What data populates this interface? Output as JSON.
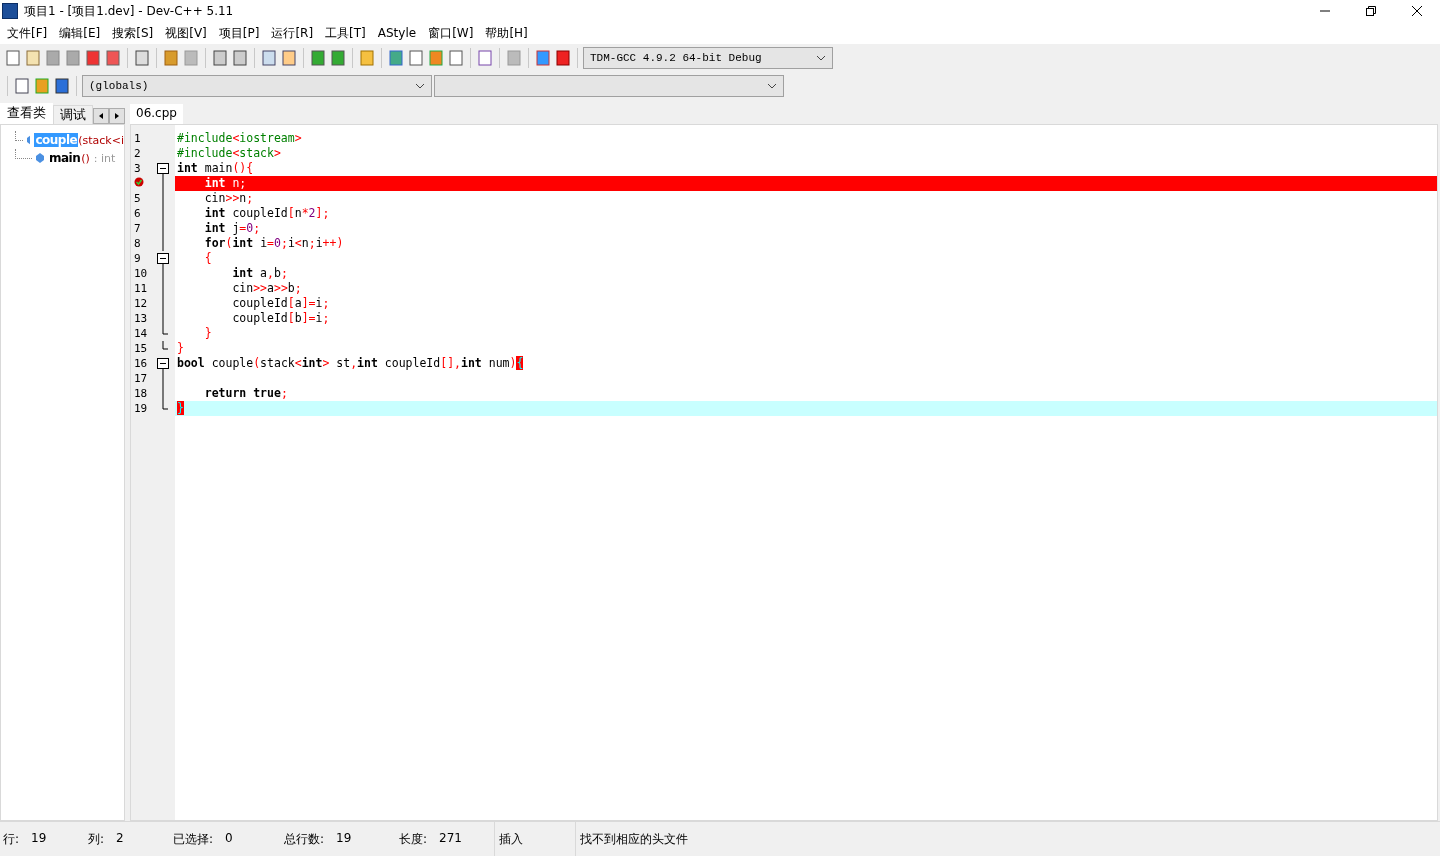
{
  "window": {
    "title": "项目1 - [项目1.dev] - Dev-C++ 5.11"
  },
  "menu": [
    "文件[F]",
    "编辑[E]",
    "搜索[S]",
    "视图[V]",
    "项目[P]",
    "运行[R]",
    "工具[T]",
    "AStyle",
    "窗口[W]",
    "帮助[H]"
  ],
  "compiler_select": {
    "value": "TDM-GCC 4.9.2 64-bit Debug"
  },
  "scope_select": {
    "value": "(globals)"
  },
  "left_tabs": [
    {
      "label": "查看类",
      "selected": true
    },
    {
      "label": "调试",
      "selected": false
    }
  ],
  "class_tree": [
    {
      "name": "couple",
      "signature": "(stack<i",
      "selected": true
    },
    {
      "name": "main",
      "signature": "()",
      "type": ": int",
      "selected": false
    }
  ],
  "editor_tabs": [
    {
      "label": "06.cpp",
      "selected": true
    }
  ],
  "code_lines": [
    {
      "number": "1",
      "text": "#include<iostream>",
      "kind": "preproc",
      "fold_start": false,
      "fold_end": false
    },
    {
      "number": "2",
      "text": "#include<stack>",
      "kind": "preproc",
      "fold_start": false,
      "fold_end": false
    },
    {
      "number": "3",
      "text": "**int** main(){",
      "kind": "code",
      "fold_start": true,
      "fold_end": false
    },
    {
      "text": "    **int** n;",
      "kind": "breakpoint",
      "fold_start": false,
      "fold_end": false
    },
    {
      "number": "5",
      "text": "    cin>>n;",
      "kind": "code",
      "fold_start": false,
      "fold_end": false
    },
    {
      "number": "6",
      "text": "    **int** coupleId[n*2];",
      "kind": "code",
      "fold_start": false,
      "fold_end": false
    },
    {
      "number": "7",
      "text": "    **int** j=0;",
      "kind": "code",
      "fold_start": false,
      "fold_end": false
    },
    {
      "number": "8",
      "text": "    **for**(**int** i=0;i<n;i++)",
      "kind": "code",
      "fold_start": false,
      "fold_end": false
    },
    {
      "number": "9",
      "text": "    {",
      "kind": "code",
      "fold_start": true,
      "fold_end": false
    },
    {
      "number": "10",
      "text": "        **int** a,b;",
      "kind": "code",
      "fold_start": false,
      "fold_end": false
    },
    {
      "number": "11",
      "text": "        cin>>a>>b;",
      "kind": "code",
      "fold_start": false,
      "fold_end": false
    },
    {
      "number": "12",
      "text": "        coupleId[a]=i;",
      "kind": "code",
      "fold_start": false,
      "fold_end": false
    },
    {
      "number": "13",
      "text": "        coupleId[b]=i;",
      "kind": "code",
      "fold_start": false,
      "fold_end": false
    },
    {
      "number": "14",
      "text": "    }",
      "kind": "code",
      "fold_start": false,
      "fold_end": true
    },
    {
      "number": "15",
      "text": "}",
      "kind": "code",
      "fold_start": false,
      "fold_end": true
    },
    {
      "number": "16",
      "text": "**bool** couple(stack<**int**> st,**int** coupleId[],**int** num){",
      "kind": "code",
      "fold_start": true,
      "fold_end": false,
      "bracket_match": true
    },
    {
      "number": "17",
      "kind": "code",
      "fold_start": false,
      "fold_end": false
    },
    {
      "number": "18",
      "text": "    **return** **true**;",
      "kind": "code",
      "fold_start": false,
      "fold_end": false
    },
    {
      "number": "19",
      "text": "}",
      "kind": "current",
      "fold_start": false,
      "fold_end": true,
      "bracket_match": true
    }
  ],
  "status_bar": [
    {
      "label": "行:",
      "value": "19"
    },
    {
      "label": "列:",
      "value": "2"
    },
    {
      "label": "已选择:",
      "value": "0"
    },
    {
      "label": "总行数:",
      "value": "19"
    },
    {
      "label": "长度:",
      "value": "271"
    }
  ],
  "status_mode": "插入",
  "status_message": "找不到相应的头文件"
}
